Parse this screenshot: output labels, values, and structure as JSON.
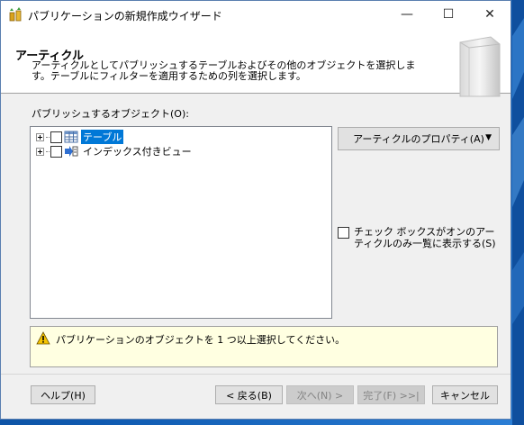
{
  "window": {
    "title": "パブリケーションの新規作成ウイザード",
    "controls": {
      "minimize": "—",
      "maximize": "☐",
      "close": "✕"
    }
  },
  "header": {
    "title": "アーティクル",
    "description": "アーティクルとしてパブリッシュするテーブルおよびその他のオブジェクトを選択します。テーブルにフィルターを適用するための列を選択します。"
  },
  "objects": {
    "label": "パブリッシュするオブジェクト(O):",
    "items": [
      {
        "label": "テーブル",
        "checked": false,
        "selected": true,
        "icon": "table-icon"
      },
      {
        "label": "インデックス付きビュー",
        "checked": false,
        "selected": false,
        "icon": "indexed-view-icon"
      }
    ]
  },
  "article_properties_button": {
    "label": "アーティクルのプロパティ(A)",
    "arrow": "▼"
  },
  "show_only_checked": {
    "label": "チェック ボックスがオンのアーティクルのみ一覧に表示する(S)",
    "checked": false
  },
  "status": {
    "message": "パブリケーションのオブジェクトを 1 つ以上選択してください。",
    "icon": "warning-icon"
  },
  "buttons": {
    "help": "ヘルプ(H)",
    "back": "< 戻る(B)",
    "next": "次へ(N) >",
    "finish": "完了(F) >>|",
    "cancel": "キャンセル"
  },
  "colors": {
    "selection": "#0078d7",
    "status_background": "#ffffe1",
    "desktop": "#0f5ab0"
  }
}
